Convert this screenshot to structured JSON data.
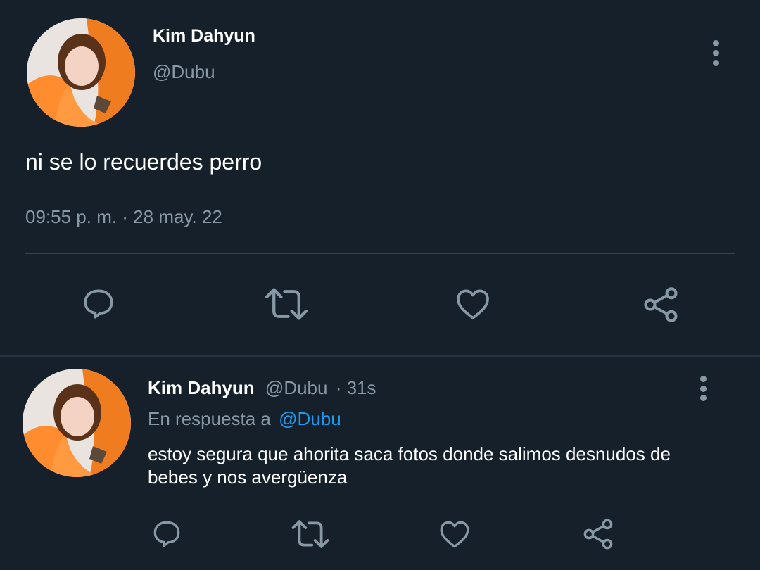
{
  "main_tweet": {
    "display_name": "Kim Dahyun",
    "handle": "@Dubu",
    "text": "ni se lo recuerdes perro",
    "timestamp": "09:55 p. m. · 28 may. 22",
    "avatar_icon": "profile-photo"
  },
  "actions": [
    "reply-icon",
    "retweet-icon",
    "like-icon",
    "share-icon"
  ],
  "reply": {
    "display_name": "Kim Dahyun",
    "handle": "@Dubu",
    "time": "· 31s",
    "in_reply_prefix": "En respuesta a",
    "in_reply_handle": "@Dubu",
    "text_line1": "estoy segura que ahorita saca fotos donde salimos desnudos de",
    "text_line2": "bebes y nos avergüenza",
    "avatar_icon": "profile-photo"
  },
  "colors": {
    "background": "#15202b",
    "muted": "#8899a6",
    "link": "#1d9bf0",
    "divider": "#38444d"
  }
}
